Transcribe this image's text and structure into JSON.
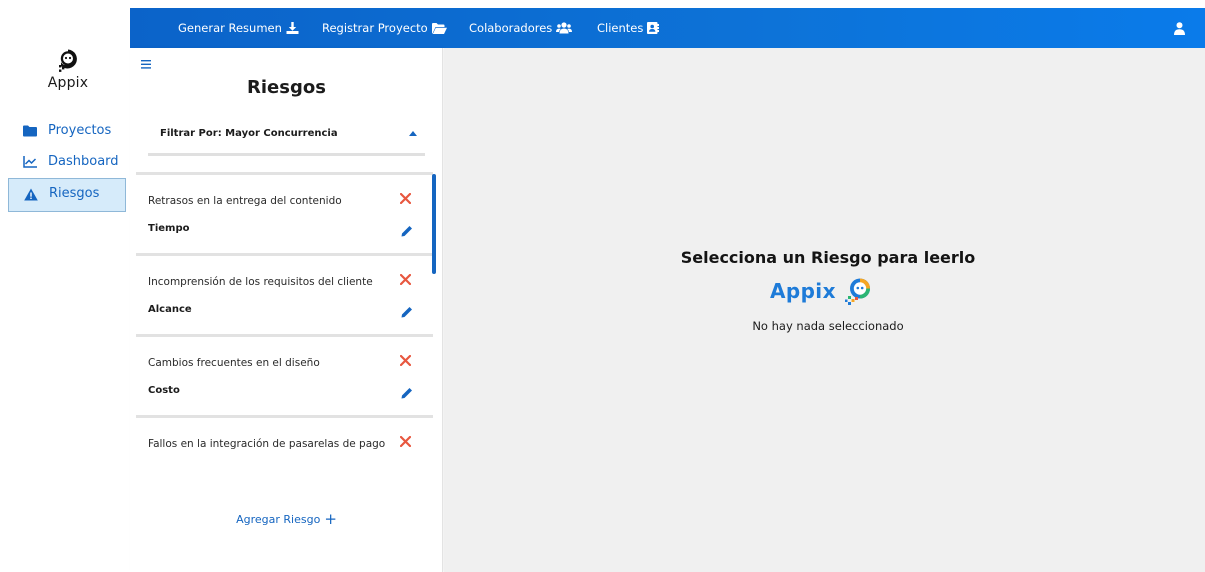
{
  "sidebar": {
    "logo_text": "Appix",
    "items": [
      {
        "label": "Proyectos",
        "icon": "folder-icon"
      },
      {
        "label": "Dashboard",
        "icon": "chart-line-icon"
      },
      {
        "label": "Riesgos",
        "icon": "warning-icon",
        "active": true
      }
    ]
  },
  "topbar": {
    "links": [
      {
        "label": "Generar Resumen",
        "icon": "download-icon"
      },
      {
        "label": "Registrar Proyecto",
        "icon": "folder-open-icon"
      },
      {
        "label": "Colaboradores",
        "icon": "users-icon"
      },
      {
        "label": "Clientes",
        "icon": "address-book-icon"
      }
    ],
    "user_icon": "user-icon",
    "colors": {
      "start": "#0b63c9",
      "end": "#0a7bea"
    }
  },
  "risk_panel": {
    "title": "Riesgos",
    "filter_label": "Filtrar Por: Mayor Concurrencia",
    "add_label": "Agregar Riesgo",
    "risks": [
      {
        "name": "Retrasos en la entrega del contenido",
        "category": "Tiempo"
      },
      {
        "name": "Incomprensión de los requisitos del cliente",
        "category": "Alcance"
      },
      {
        "name": "Cambios frecuentes en el diseño",
        "category": "Costo"
      },
      {
        "name": "Fallos en la integración de pasarelas de pago",
        "category": ""
      }
    ]
  },
  "main": {
    "empty_title": "Selecciona un Riesgo para leerlo",
    "brand": "Appix",
    "empty_subtitle": "No hay nada seleccionado"
  },
  "colors": {
    "accent": "#1565c0",
    "delete": "#e8573f",
    "background": "#f0f0f0"
  }
}
